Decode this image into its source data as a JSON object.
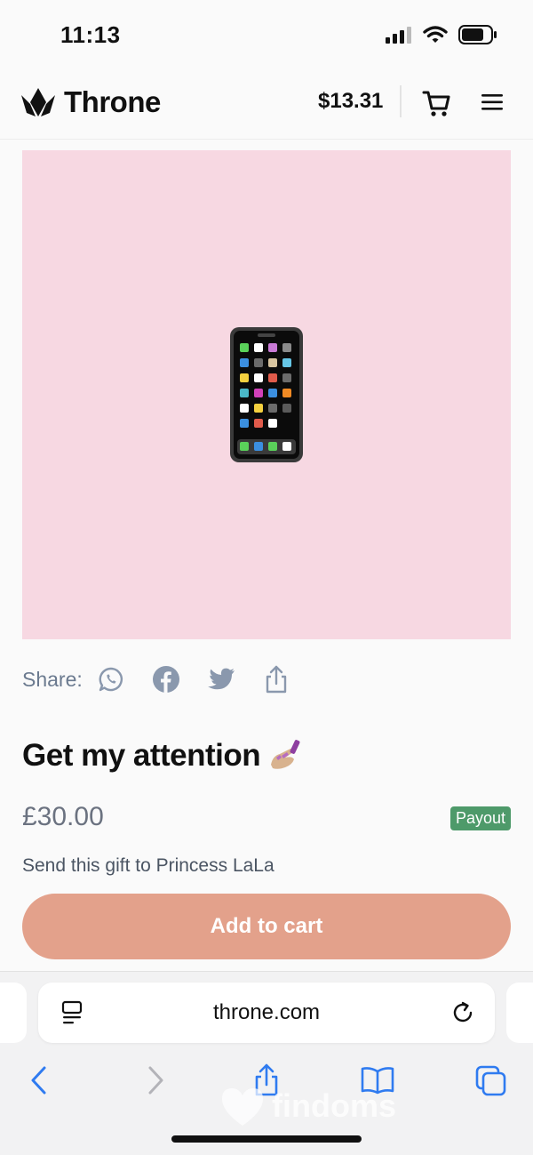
{
  "status_bar": {
    "time": "11:13"
  },
  "nav": {
    "brand": "Throne",
    "balance": "$13.31"
  },
  "product": {
    "share_label": "Share:",
    "title": "Get my attention",
    "price": "£30.00",
    "badge": "Payout",
    "gift_text": "Send this gift to Princess LaLa",
    "add_to_cart_label": "Add to cart"
  },
  "browser": {
    "url": "throne.com"
  },
  "watermark": "findoms",
  "colors": {
    "image_bg": "#f7d8e2",
    "cta": "#e3a18b",
    "badge": "#4e9a6a",
    "link_blue": "#2f7bf0"
  }
}
